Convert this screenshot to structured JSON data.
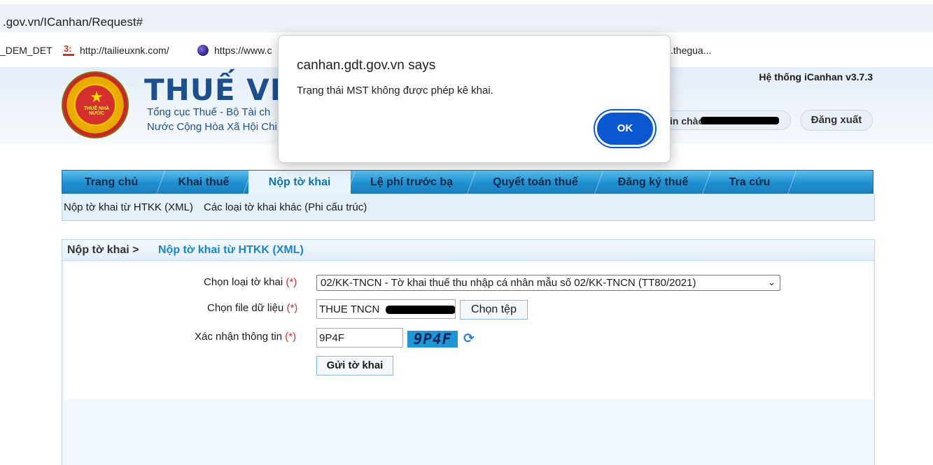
{
  "browser": {
    "url": ".gov.vn/ICanhan/Request#",
    "bookmarks": [
      {
        "label": "_DEM_DET"
      },
      {
        "label": "http://tailieuxnk.com/"
      },
      {
        "label": "https://www.c"
      },
      {
        "label": ".thegua..."
      }
    ]
  },
  "header": {
    "logo_text": "THUẾ NHÀ NƯỚC",
    "site_title": "THUẾ VIỆT",
    "subtitle1": "Tổng cục Thuế - Bộ Tài ch",
    "subtitle2": "Nước Cộng Hòa Xã Hội Chi",
    "version": "Hệ thống iCanhan v3.7.3",
    "user_label": "in chào",
    "logout": "Đăng xuất"
  },
  "nav": {
    "tabs": [
      {
        "label": "Trang chủ"
      },
      {
        "label": "Khai thuế"
      },
      {
        "label": "Nộp tờ khai"
      },
      {
        "label": "Lệ phí trước bạ"
      },
      {
        "label": "Quyết toán thuế"
      },
      {
        "label": "Đăng ký thuế"
      },
      {
        "label": "Tra cứu"
      }
    ],
    "active_tab": "Nộp tờ khai",
    "subitems": [
      {
        "label": "Nộp tờ khai từ HTKK (XML)"
      },
      {
        "label": "Các loại tờ khai khác (Phi cấu trúc)"
      }
    ]
  },
  "panel": {
    "crumb_parent": "Nộp tờ khai >",
    "crumb_current": "Nộp tờ khai từ HTKK (XML)"
  },
  "form": {
    "req_marker": "(*)",
    "declaration_label": "Chọn loại tờ khai",
    "declaration_value": "02/KK-TNCN - Tờ khai thuế thu nhập cá nhân mẫu số 02/KK-TNCN (TT80/2021)",
    "file_label": "Chọn file dữ liệu",
    "file_value": "THUE TNCN",
    "choose_file": "Chọn tệp",
    "captcha_label": "Xác nhận thông tin",
    "captcha_value": "9P4F",
    "captcha_image_text": "9P4F",
    "submit": "Gửi tờ khai"
  },
  "dialog": {
    "title": "canhan.gdt.gov.vn says",
    "message": "Trạng thái MST không được phép kê khai.",
    "ok": "OK"
  },
  "colors": {
    "nav_blue": "#1f8fd1",
    "link_blue": "#1a86c8",
    "required_red": "#d32f2f",
    "ok_button": "#0b57d0"
  }
}
